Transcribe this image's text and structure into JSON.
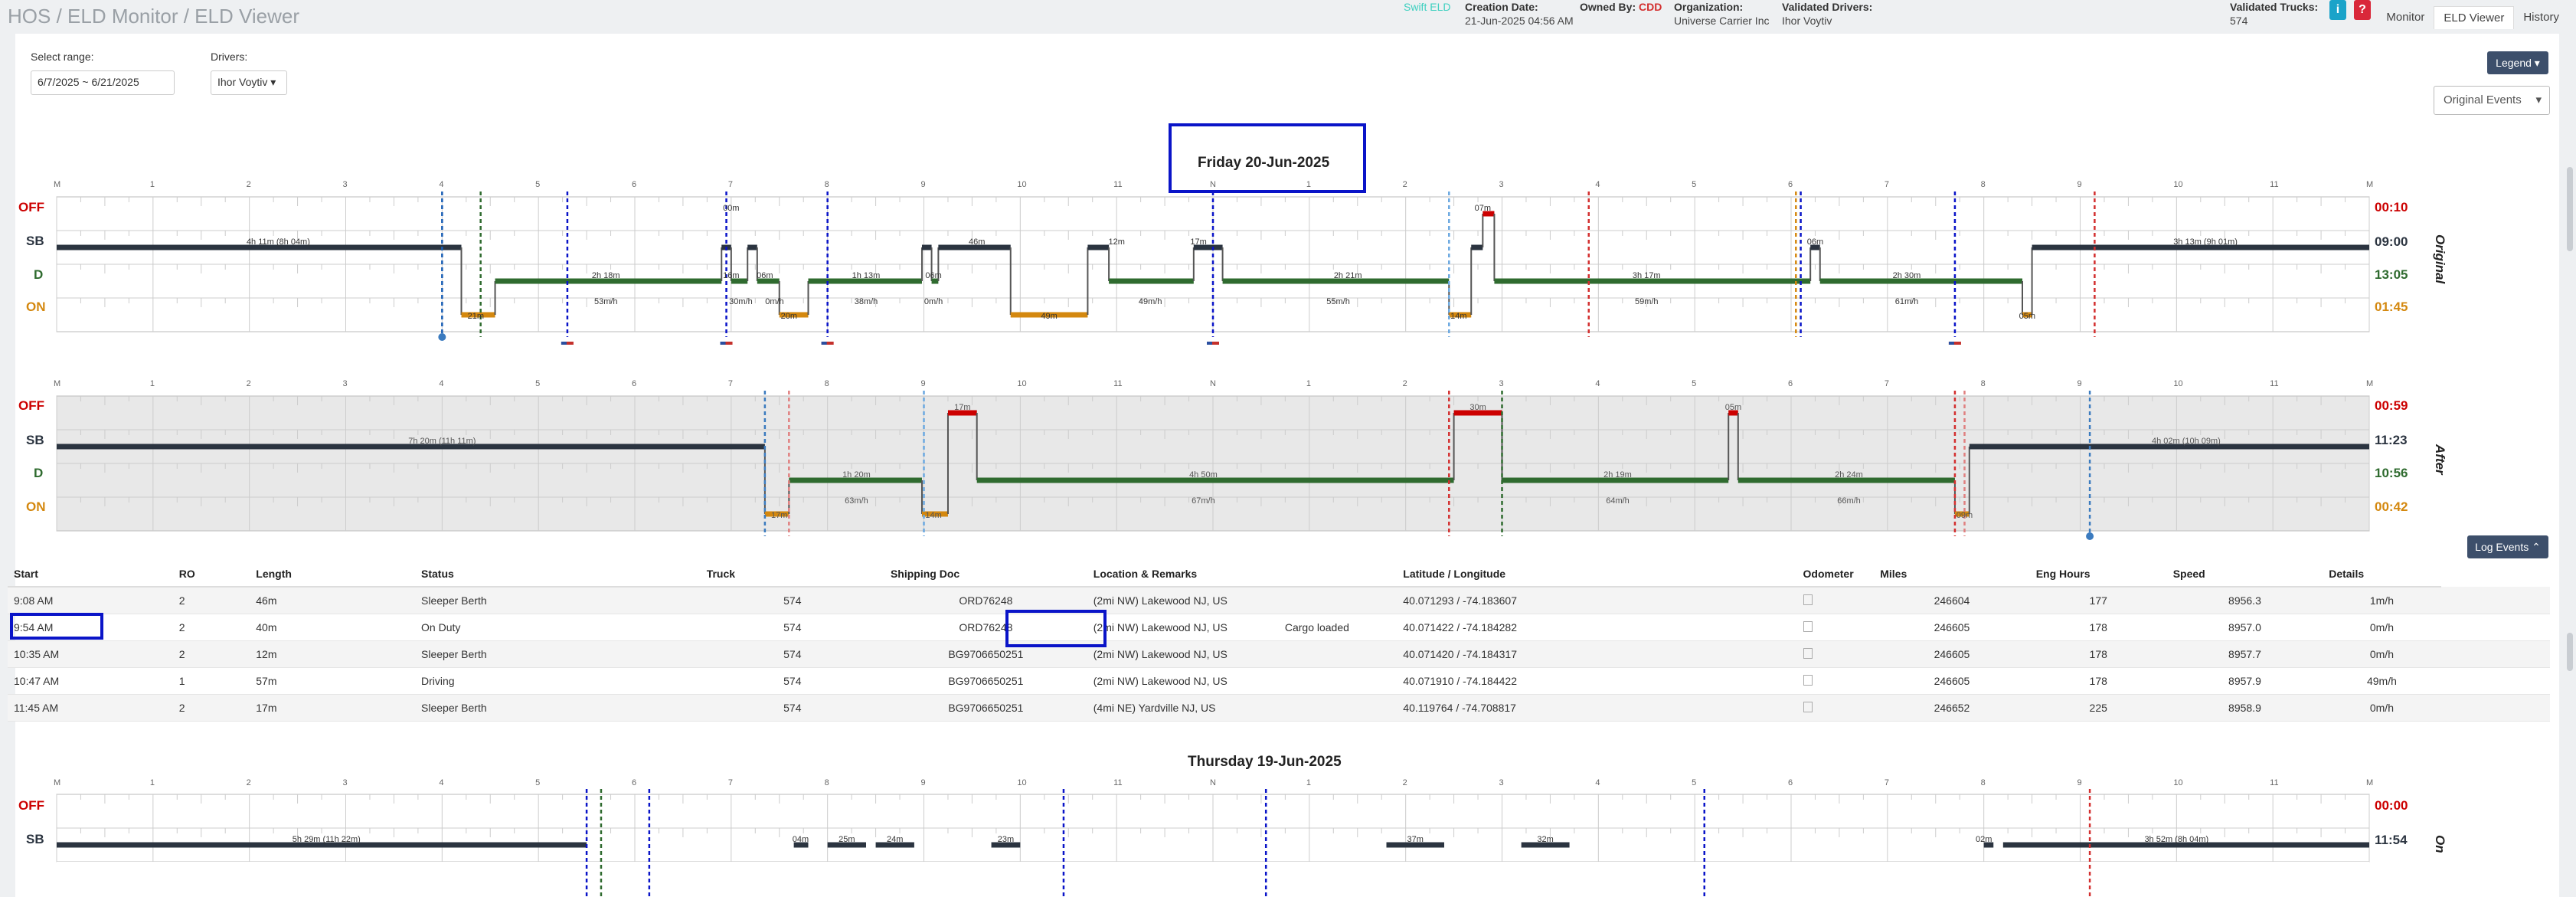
{
  "header": {
    "breadcrumb": "HOS / ELD Monitor / ELD Viewer",
    "app_name": "Swift ELD",
    "creation_label": "Creation Date:",
    "creation_value": "21-Jun-2025 04:56 AM",
    "owned_label": "Owned By:",
    "owned_value": "CDD",
    "org_label": "Organization:",
    "org_value": "Universe Carrier Inc",
    "validated_drivers_label": "Validated Drivers:",
    "validated_drivers_value": "Ihor Voytiv",
    "validated_trucks_label": "Validated Trucks:",
    "validated_trucks_value": "574",
    "info_icon_glyph": "i",
    "help_icon_glyph": "?",
    "tabs": [
      "Monitor",
      "ELD Viewer",
      "History"
    ]
  },
  "filters": {
    "range_label": "Select range:",
    "range_value": "6/7/2025 ~ 6/21/2025",
    "drivers_label": "Drivers:",
    "driver_value": "Ihor Voytiv ▾",
    "legend_button": "Legend ▾",
    "events_select": "Original Events"
  },
  "hours": [
    "M",
    "1",
    "2",
    "3",
    "4",
    "5",
    "6",
    "7",
    "8",
    "9",
    "10",
    "11",
    "N",
    "1",
    "2",
    "3",
    "4",
    "5",
    "6",
    "7",
    "8",
    "9",
    "10",
    "11",
    "M"
  ],
  "status_rows": [
    "OFF",
    "SB",
    "D",
    "ON"
  ],
  "day1": {
    "title": "Friday 20-Jun-2025",
    "original": {
      "side_label": "Original",
      "totals": [
        "00:10",
        "09:00",
        "13:05",
        "01:45"
      ],
      "duration_labels": [
        "4h 11m (8h 04m)",
        "2h 18m",
        "16m",
        "06m",
        "1h 13m",
        "06m",
        "46m",
        "12m",
        "17m",
        "2h 21m",
        "07m",
        "3h 17m",
        "06m",
        "2h 30m",
        "3h 13m (9h 01m)",
        "21m",
        "20m",
        "49m",
        "14m",
        "05m",
        "00m"
      ],
      "speed_labels": [
        "53m/h",
        "30m/h",
        "0m/h",
        "38m/h",
        "0m/h",
        "49m/h",
        "55m/h",
        "59m/h",
        "61m/h"
      ]
    },
    "after": {
      "side_label": "After",
      "totals": [
        "00:59",
        "11:23",
        "10:56",
        "00:42"
      ],
      "duration_labels": [
        "7h 20m (11h 11m)",
        "17m",
        "30m",
        "05m",
        "1h 20m",
        "4h 50m",
        "2h 19m",
        "2h 24m",
        "4h 02m (10h 09m)",
        "17m",
        "14m",
        "09m"
      ],
      "speed_labels": [
        "63m/h",
        "67m/h",
        "64m/h",
        "66m/h"
      ]
    },
    "log_events_button": "Log Events ⌃"
  },
  "table": {
    "columns": [
      "Start",
      "RO",
      "Length",
      "Status",
      "Truck",
      "Shipping Doc",
      "Location & Remarks",
      "Latitude / Longitude",
      "",
      "Odometer",
      "Miles",
      "Eng Hours",
      "Speed",
      "Details"
    ],
    "rows": [
      [
        "9:08 AM",
        "2",
        "46m",
        "Sleeper Berth",
        "574",
        "ORD76248",
        "(2mi NW) Lakewood NJ, US",
        "",
        "40.071293 / -74.183607",
        "246604",
        "177",
        "8956.3",
        "1m/h",
        ""
      ],
      [
        "9:54 AM",
        "2",
        "40m",
        "On Duty",
        "574",
        "ORD76248",
        "(2mi NW) Lakewood NJ, US",
        "Cargo loaded",
        "40.071422 / -74.184282",
        "246605",
        "178",
        "8957.0",
        "0m/h",
        ""
      ],
      [
        "10:35 AM",
        "2",
        "12m",
        "Sleeper Berth",
        "574",
        "BG9706650251",
        "(2mi NW) Lakewood NJ, US",
        "",
        "40.071420 / -74.184317",
        "246605",
        "178",
        "8957.7",
        "0m/h",
        ""
      ],
      [
        "10:47 AM",
        "1",
        "57m",
        "Driving",
        "574",
        "BG9706650251",
        "(2mi NW) Lakewood NJ, US",
        "",
        "40.071910 / -74.184422",
        "246605",
        "178",
        "8957.9",
        "49m/h",
        ""
      ],
      [
        "11:45 AM",
        "2",
        "17m",
        "Sleeper Berth",
        "574",
        "BG9706650251",
        "(4mi NE) Yardville NJ, US",
        "",
        "40.119764 / -74.708817",
        "246652",
        "225",
        "8958.9",
        "0m/h",
        ""
      ]
    ]
  },
  "day2": {
    "title": "Thursday 19-Jun-2025",
    "side_label": "On",
    "totals": [
      "00:00",
      "11:54"
    ],
    "duration_labels": [
      "5h 29m (11h 22m)",
      "04m",
      "25m",
      "24m",
      "23m",
      "37m",
      "32m",
      "02m",
      "3h 52m (8h 04m)"
    ]
  },
  "colors": {
    "off": "#cc0000",
    "sb": "#2b3440",
    "d": "#2f6b2f",
    "on": "#d4880f",
    "highlight": "#0a14c8",
    "accent_button": "#3d4f6b"
  }
}
